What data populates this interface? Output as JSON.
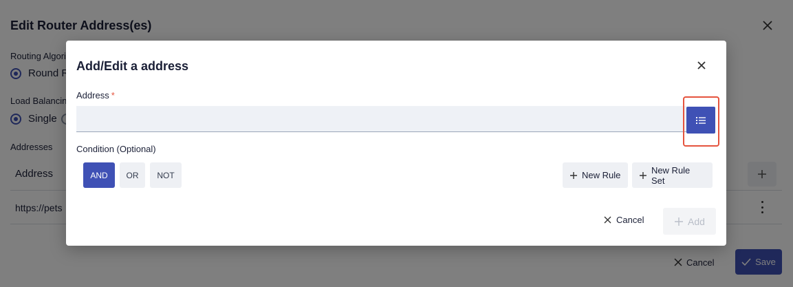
{
  "background": {
    "title": "Edit Router Address(es)",
    "routing_label": "Routing Algori",
    "routing_option": "Round R",
    "load_balancing_label": "Load Balancin",
    "load_balancing_option": "Single",
    "addresses_label": "Addresses",
    "table": {
      "column_header": "Address",
      "rows": [
        "https://pets"
      ]
    },
    "cancel_label": "Cancel",
    "save_label": "Save",
    "icons": [
      "close-icon",
      "plus-icon",
      "kebab-icon",
      "check-icon"
    ]
  },
  "modal": {
    "title": "Add/Edit a address",
    "address_label": "Address",
    "required_marker": "*",
    "address_value": "",
    "condition_label": "Condition (Optional)",
    "operators": [
      "AND",
      "OR",
      "NOT"
    ],
    "selected_operator": "AND",
    "new_rule_label": "New Rule",
    "new_rule_set_label": "New Rule Set",
    "cancel_label": "Cancel",
    "add_label": "Add",
    "icons": [
      "close-icon",
      "list-icon",
      "plus-icon"
    ]
  },
  "colors": {
    "primary": "#3f51b5",
    "highlight": "#e5533d",
    "required": "#e5533d",
    "input_bg": "#eef1f6",
    "disabled_text": "#b9bec8"
  }
}
